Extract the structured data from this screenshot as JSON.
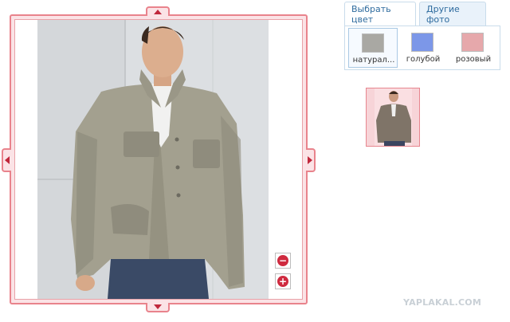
{
  "viewer": {
    "zoom_out_label": "−",
    "zoom_in_label": "+",
    "icons": {
      "nav_up": "arrow-up-icon",
      "nav_down": "arrow-down-icon",
      "nav_left": "arrow-left-icon",
      "nav_right": "arrow-right-icon"
    }
  },
  "picker": {
    "tabs": [
      {
        "label": "Выбрать цвет",
        "active": true
      },
      {
        "label": "Другие фото",
        "active": false
      }
    ],
    "colors": [
      {
        "label": "натурал...",
        "color": "#a9a8a3",
        "selected": true
      },
      {
        "label": "голубой",
        "color": "#7c97e8",
        "selected": false
      },
      {
        "label": "розовый",
        "color": "#e6a8ab",
        "selected": false
      }
    ]
  },
  "watermark": "YAPLAKAL.COM"
}
